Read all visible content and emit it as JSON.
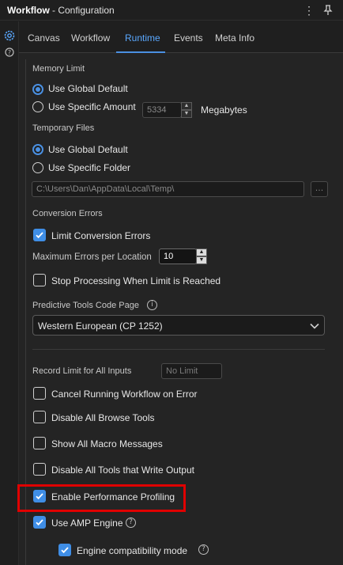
{
  "titlebar": {
    "title": "Workflow",
    "subtitle": "- Configuration",
    "icons": [
      "more-vertical-icon",
      "pin-icon"
    ]
  },
  "rail": {
    "icons": [
      "gear-icon",
      "help-icon"
    ]
  },
  "tabs": [
    "Canvas",
    "Workflow",
    "Runtime",
    "Events",
    "Meta Info"
  ],
  "active_tab": "Runtime",
  "memory": {
    "heading": "Memory Limit",
    "opt_default": "Use Global Default",
    "opt_specific": "Use Specific Amount",
    "amount": "5334",
    "unit": "Megabytes",
    "selected": "Use Global Default"
  },
  "temp": {
    "heading": "Temporary Files",
    "opt_default": "Use Global Default",
    "opt_specific": "Use Specific Folder",
    "path": "C:\\Users\\Dan\\AppData\\Local\\Temp\\",
    "browse": "…",
    "selected": "Use Global Default"
  },
  "conversion": {
    "heading": "Conversion Errors",
    "limit_label": "Limit Conversion Errors",
    "limit_checked": true,
    "max_label": "Maximum Errors per Location",
    "max_value": "10",
    "stop_label": "Stop Processing When Limit is Reached",
    "stop_checked": false
  },
  "codepage": {
    "heading": "Predictive Tools Code Page",
    "value": "Western European (CP 1252)"
  },
  "record_limit": {
    "label": "Record Limit for All Inputs",
    "placeholder": "No Limit"
  },
  "options": [
    {
      "label": "Cancel Running Workflow on Error",
      "checked": false
    },
    {
      "label": "Disable All Browse Tools",
      "checked": false
    },
    {
      "label": "Show All Macro Messages",
      "checked": false
    },
    {
      "label": "Disable All Tools that Write Output",
      "checked": false
    },
    {
      "label": "Enable Performance Profiling",
      "checked": true
    },
    {
      "label": "Use AMP Engine",
      "checked": true
    },
    {
      "label": "Engine compatibility mode",
      "checked": true
    }
  ],
  "colors": {
    "accent": "#3f8ee6",
    "highlight": "#e00000",
    "background": "#242424"
  }
}
